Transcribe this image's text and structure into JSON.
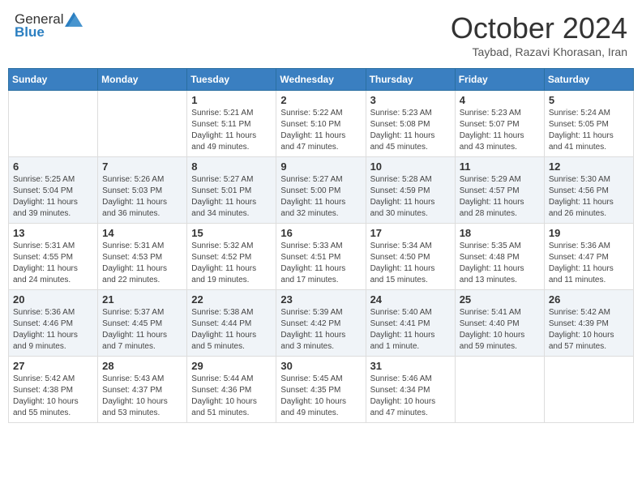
{
  "header": {
    "logo_general": "General",
    "logo_blue": "Blue",
    "month_title": "October 2024",
    "subtitle": "Taybad, Razavi Khorasan, Iran"
  },
  "weekdays": [
    "Sunday",
    "Monday",
    "Tuesday",
    "Wednesday",
    "Thursday",
    "Friday",
    "Saturday"
  ],
  "weeks": [
    [
      {
        "day": "",
        "sunrise": "",
        "sunset": "",
        "daylight": ""
      },
      {
        "day": "",
        "sunrise": "",
        "sunset": "",
        "daylight": ""
      },
      {
        "day": "1",
        "sunrise": "Sunrise: 5:21 AM",
        "sunset": "Sunset: 5:11 PM",
        "daylight": "Daylight: 11 hours and 49 minutes."
      },
      {
        "day": "2",
        "sunrise": "Sunrise: 5:22 AM",
        "sunset": "Sunset: 5:10 PM",
        "daylight": "Daylight: 11 hours and 47 minutes."
      },
      {
        "day": "3",
        "sunrise": "Sunrise: 5:23 AM",
        "sunset": "Sunset: 5:08 PM",
        "daylight": "Daylight: 11 hours and 45 minutes."
      },
      {
        "day": "4",
        "sunrise": "Sunrise: 5:23 AM",
        "sunset": "Sunset: 5:07 PM",
        "daylight": "Daylight: 11 hours and 43 minutes."
      },
      {
        "day": "5",
        "sunrise": "Sunrise: 5:24 AM",
        "sunset": "Sunset: 5:05 PM",
        "daylight": "Daylight: 11 hours and 41 minutes."
      }
    ],
    [
      {
        "day": "6",
        "sunrise": "Sunrise: 5:25 AM",
        "sunset": "Sunset: 5:04 PM",
        "daylight": "Daylight: 11 hours and 39 minutes."
      },
      {
        "day": "7",
        "sunrise": "Sunrise: 5:26 AM",
        "sunset": "Sunset: 5:03 PM",
        "daylight": "Daylight: 11 hours and 36 minutes."
      },
      {
        "day": "8",
        "sunrise": "Sunrise: 5:27 AM",
        "sunset": "Sunset: 5:01 PM",
        "daylight": "Daylight: 11 hours and 34 minutes."
      },
      {
        "day": "9",
        "sunrise": "Sunrise: 5:27 AM",
        "sunset": "Sunset: 5:00 PM",
        "daylight": "Daylight: 11 hours and 32 minutes."
      },
      {
        "day": "10",
        "sunrise": "Sunrise: 5:28 AM",
        "sunset": "Sunset: 4:59 PM",
        "daylight": "Daylight: 11 hours and 30 minutes."
      },
      {
        "day": "11",
        "sunrise": "Sunrise: 5:29 AM",
        "sunset": "Sunset: 4:57 PM",
        "daylight": "Daylight: 11 hours and 28 minutes."
      },
      {
        "day": "12",
        "sunrise": "Sunrise: 5:30 AM",
        "sunset": "Sunset: 4:56 PM",
        "daylight": "Daylight: 11 hours and 26 minutes."
      }
    ],
    [
      {
        "day": "13",
        "sunrise": "Sunrise: 5:31 AM",
        "sunset": "Sunset: 4:55 PM",
        "daylight": "Daylight: 11 hours and 24 minutes."
      },
      {
        "day": "14",
        "sunrise": "Sunrise: 5:31 AM",
        "sunset": "Sunset: 4:53 PM",
        "daylight": "Daylight: 11 hours and 22 minutes."
      },
      {
        "day": "15",
        "sunrise": "Sunrise: 5:32 AM",
        "sunset": "Sunset: 4:52 PM",
        "daylight": "Daylight: 11 hours and 19 minutes."
      },
      {
        "day": "16",
        "sunrise": "Sunrise: 5:33 AM",
        "sunset": "Sunset: 4:51 PM",
        "daylight": "Daylight: 11 hours and 17 minutes."
      },
      {
        "day": "17",
        "sunrise": "Sunrise: 5:34 AM",
        "sunset": "Sunset: 4:50 PM",
        "daylight": "Daylight: 11 hours and 15 minutes."
      },
      {
        "day": "18",
        "sunrise": "Sunrise: 5:35 AM",
        "sunset": "Sunset: 4:48 PM",
        "daylight": "Daylight: 11 hours and 13 minutes."
      },
      {
        "day": "19",
        "sunrise": "Sunrise: 5:36 AM",
        "sunset": "Sunset: 4:47 PM",
        "daylight": "Daylight: 11 hours and 11 minutes."
      }
    ],
    [
      {
        "day": "20",
        "sunrise": "Sunrise: 5:36 AM",
        "sunset": "Sunset: 4:46 PM",
        "daylight": "Daylight: 11 hours and 9 minutes."
      },
      {
        "day": "21",
        "sunrise": "Sunrise: 5:37 AM",
        "sunset": "Sunset: 4:45 PM",
        "daylight": "Daylight: 11 hours and 7 minutes."
      },
      {
        "day": "22",
        "sunrise": "Sunrise: 5:38 AM",
        "sunset": "Sunset: 4:44 PM",
        "daylight": "Daylight: 11 hours and 5 minutes."
      },
      {
        "day": "23",
        "sunrise": "Sunrise: 5:39 AM",
        "sunset": "Sunset: 4:42 PM",
        "daylight": "Daylight: 11 hours and 3 minutes."
      },
      {
        "day": "24",
        "sunrise": "Sunrise: 5:40 AM",
        "sunset": "Sunset: 4:41 PM",
        "daylight": "Daylight: 11 hours and 1 minute."
      },
      {
        "day": "25",
        "sunrise": "Sunrise: 5:41 AM",
        "sunset": "Sunset: 4:40 PM",
        "daylight": "Daylight: 10 hours and 59 minutes."
      },
      {
        "day": "26",
        "sunrise": "Sunrise: 5:42 AM",
        "sunset": "Sunset: 4:39 PM",
        "daylight": "Daylight: 10 hours and 57 minutes."
      }
    ],
    [
      {
        "day": "27",
        "sunrise": "Sunrise: 5:42 AM",
        "sunset": "Sunset: 4:38 PM",
        "daylight": "Daylight: 10 hours and 55 minutes."
      },
      {
        "day": "28",
        "sunrise": "Sunrise: 5:43 AM",
        "sunset": "Sunset: 4:37 PM",
        "daylight": "Daylight: 10 hours and 53 minutes."
      },
      {
        "day": "29",
        "sunrise": "Sunrise: 5:44 AM",
        "sunset": "Sunset: 4:36 PM",
        "daylight": "Daylight: 10 hours and 51 minutes."
      },
      {
        "day": "30",
        "sunrise": "Sunrise: 5:45 AM",
        "sunset": "Sunset: 4:35 PM",
        "daylight": "Daylight: 10 hours and 49 minutes."
      },
      {
        "day": "31",
        "sunrise": "Sunrise: 5:46 AM",
        "sunset": "Sunset: 4:34 PM",
        "daylight": "Daylight: 10 hours and 47 minutes."
      },
      {
        "day": "",
        "sunrise": "",
        "sunset": "",
        "daylight": ""
      },
      {
        "day": "",
        "sunrise": "",
        "sunset": "",
        "daylight": ""
      }
    ]
  ]
}
